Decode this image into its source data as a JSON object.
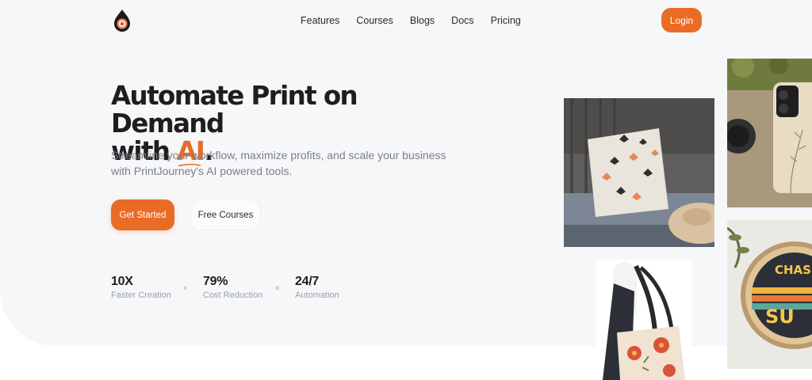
{
  "brand": {
    "logo": "droplet-target-icon",
    "accent": "#ea6b25"
  },
  "nav": {
    "links": [
      "Features",
      "Courses",
      "Blogs",
      "Docs",
      "Pricing"
    ],
    "login": "Login"
  },
  "hero": {
    "headline_line1": "Automate Print on Demand",
    "headline_prefix": "with ",
    "headline_accent": "AI",
    "headline_suffix": ".",
    "subtext": "Streamline your workflow, maximize profits, and scale your business with PrintJourney's AI powered tools.",
    "cta_primary": "Get Started",
    "cta_secondary": "Free Courses"
  },
  "stats": [
    {
      "value": "10X",
      "label": "Faster Creation"
    },
    {
      "value": "79%",
      "label": "Cost Reduction"
    },
    {
      "value": "24/7",
      "label": "Automation"
    }
  ],
  "images": [
    {
      "name": "butterfly-pillow-image",
      "content": "pillow with butterflies"
    },
    {
      "name": "phone-case-image",
      "content": "floral phone case"
    },
    {
      "name": "tote-bag-image",
      "content": "floral tote bag"
    },
    {
      "name": "round-sign-image",
      "content": "retro round sign"
    }
  ]
}
